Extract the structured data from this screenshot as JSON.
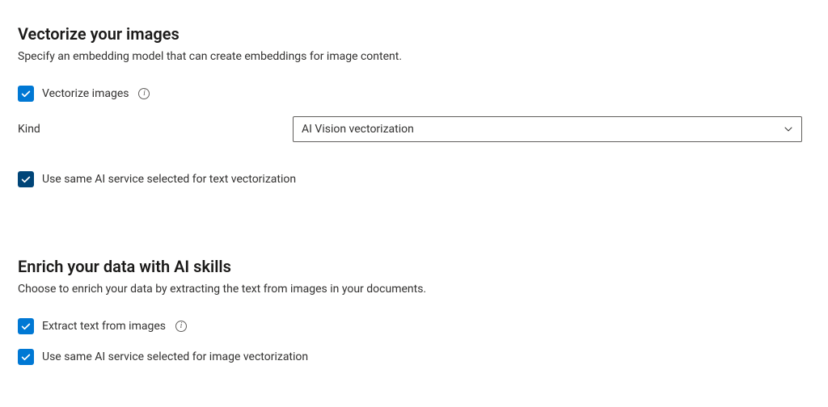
{
  "vectorize": {
    "title": "Vectorize your images",
    "desc": "Specify an embedding model that can create embeddings for image content.",
    "checkbox_label": "Vectorize images",
    "kind_label": "Kind",
    "kind_value": "AI Vision vectorization",
    "use_same_label": "Use same AI service selected for text vectorization"
  },
  "enrich": {
    "title": "Enrich your data with AI skills",
    "desc": "Choose to enrich your data by extracting the text from images in your documents.",
    "extract_label": "Extract text from images",
    "use_same_label": "Use same AI service selected for image vectorization"
  }
}
